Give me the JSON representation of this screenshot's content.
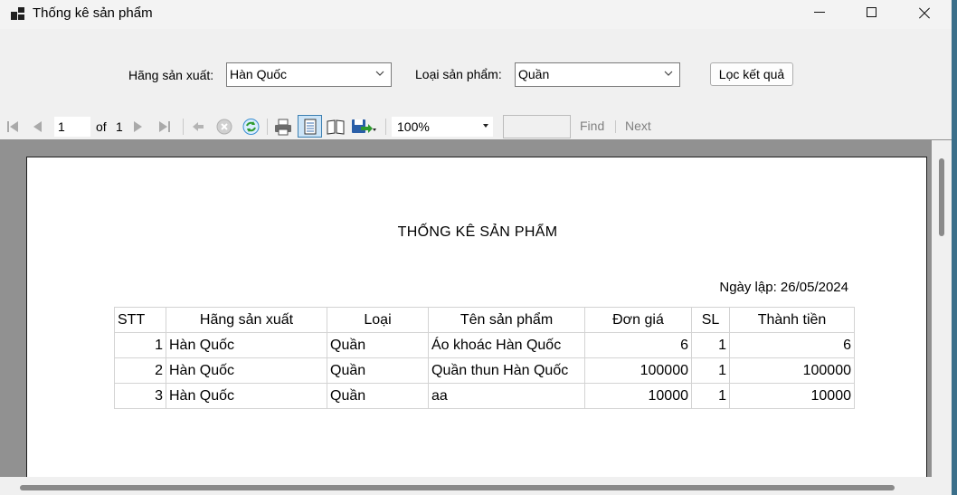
{
  "window": {
    "title": "Thống kê sản phẩm"
  },
  "filter": {
    "brand_label": "Hãng sản xuất:",
    "brand_value": "Hàn Quốc",
    "type_label": "Loại sản phẩm:",
    "type_value": "Quần",
    "filter_button": "Lọc kết quả"
  },
  "toolbar": {
    "current_page": "1",
    "of_label": "of",
    "total_pages": "1",
    "zoom": "100%",
    "find_label": "Find",
    "next_label": "Next"
  },
  "report": {
    "title": "THỐNG KÊ SẢN PHẨM",
    "date_text": "Ngày lập: 26/05/2024",
    "columns": [
      "STT",
      "Hãng sản xuất",
      "Loại",
      "Tên sản phẩm",
      "Đơn giá",
      "SL",
      "Thành tiền"
    ],
    "rows": [
      [
        "1",
        "Hàn Quốc",
        "Quần",
        "Áo khoác Hàn Quốc",
        "6",
        "1",
        "6"
      ],
      [
        "2",
        "Hàn Quốc",
        "Quần",
        "Quần thun Hàn Quốc",
        "100000",
        "1",
        "100000"
      ],
      [
        "3",
        "Hàn Quốc",
        "Quần",
        "aa",
        "10000",
        "1",
        "10000"
      ]
    ]
  }
}
